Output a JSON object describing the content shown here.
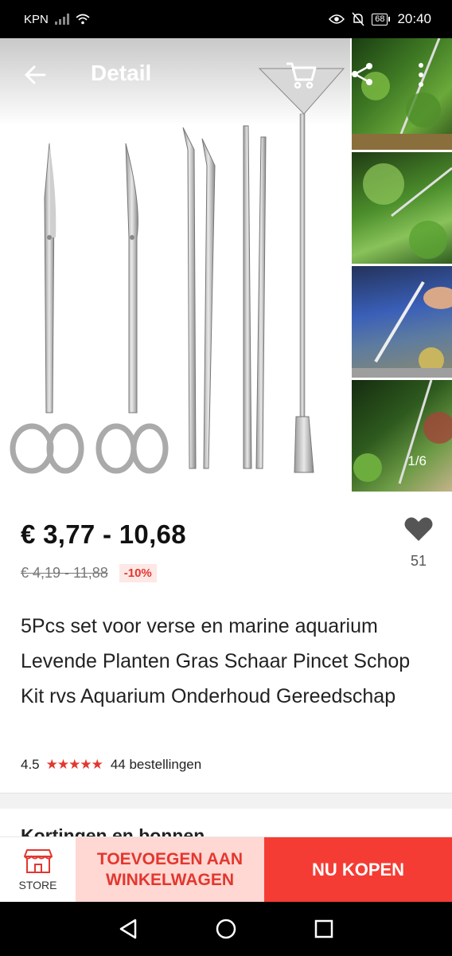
{
  "status_bar": {
    "carrier": "KPN",
    "battery": "68",
    "time": "20:40",
    "icons": [
      "signal-icon",
      "wifi-icon",
      "eye-icon",
      "mute-bell-icon",
      "battery-icon"
    ]
  },
  "header": {
    "title": "Detail",
    "icons": [
      "back-arrow-icon",
      "cart-icon",
      "share-icon",
      "more-vertical-icon"
    ]
  },
  "gallery": {
    "pager": "1/6",
    "main_image": "aquarium tool set: two scissors, two tweezers, spatula",
    "thumbnail_count": 4
  },
  "product": {
    "price": "€ 3,77 - 10,68",
    "original_price": "€ 4,19 - 11,88",
    "discount": "-10%",
    "wishlist_count": "51",
    "title": "5Pcs set voor verse en marine aquarium Levende Planten Gras Schaar Pincet Schop Kit rvs Aquarium Onderhoud Gereedschap",
    "rating": "4.5",
    "stars": "★★★★★",
    "orders": "44 bestellingen"
  },
  "next_section": {
    "title": "Kortingen en bonnen"
  },
  "actions": {
    "store_label": "STORE",
    "add_to_cart": "TOEVOEGEN AAN WINKELWAGEN",
    "buy_now": "NU KOPEN"
  },
  "colors": {
    "accent": "#f53c34",
    "accent_light": "#ffd7d3",
    "star": "#e3372e"
  }
}
